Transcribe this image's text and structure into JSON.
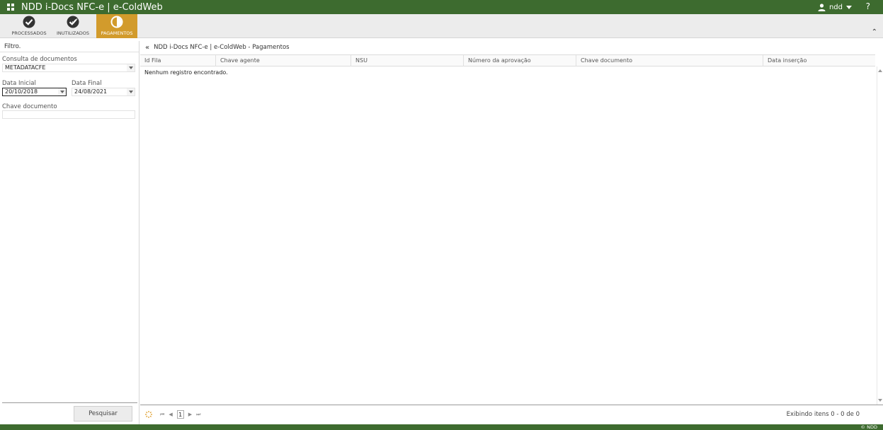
{
  "app": {
    "title": "NDD i-Docs NFC-e | e-ColdWeb"
  },
  "user": {
    "name": "ndd",
    "help": "?"
  },
  "ribbon": {
    "tabs": [
      {
        "label": "PROCESSADOS",
        "icon": "check-circle-icon"
      },
      {
        "label": "INUTILIZADOS",
        "icon": "check-circle-icon"
      },
      {
        "label": "PAGAMENTOS",
        "icon": "half-circle-icon",
        "active": true
      }
    ],
    "active_color": "#d29b2c"
  },
  "filter": {
    "heading": "Filtro.",
    "consulta_label": "Consulta de documentos",
    "consulta_value": "METADATACFE",
    "data_inicial_label": "Data Inicial",
    "data_inicial_value": "20/10/2018",
    "data_final_label": "Data Final",
    "data_final_value": "24/08/2021",
    "chave_label": "Chave documento",
    "chave_value": "",
    "search_button": "Pesquisar"
  },
  "breadcrumb": {
    "text": "NDD i-Docs NFC-e | e-ColdWeb - Pagamentos"
  },
  "grid": {
    "columns": [
      "Id Fila",
      "Chave agente",
      "NSU",
      "Número da aprovação",
      "Chave documento",
      "Data inserção"
    ],
    "empty_text": "Nenhum registro encontrado."
  },
  "pager": {
    "current_page": "1",
    "info": "Exibindo itens 0 - 0 de 0"
  },
  "footer": {
    "text": "© NDD"
  },
  "colors": {
    "brand_green": "#3d6b2f",
    "accent_orange": "#d29b2c"
  }
}
